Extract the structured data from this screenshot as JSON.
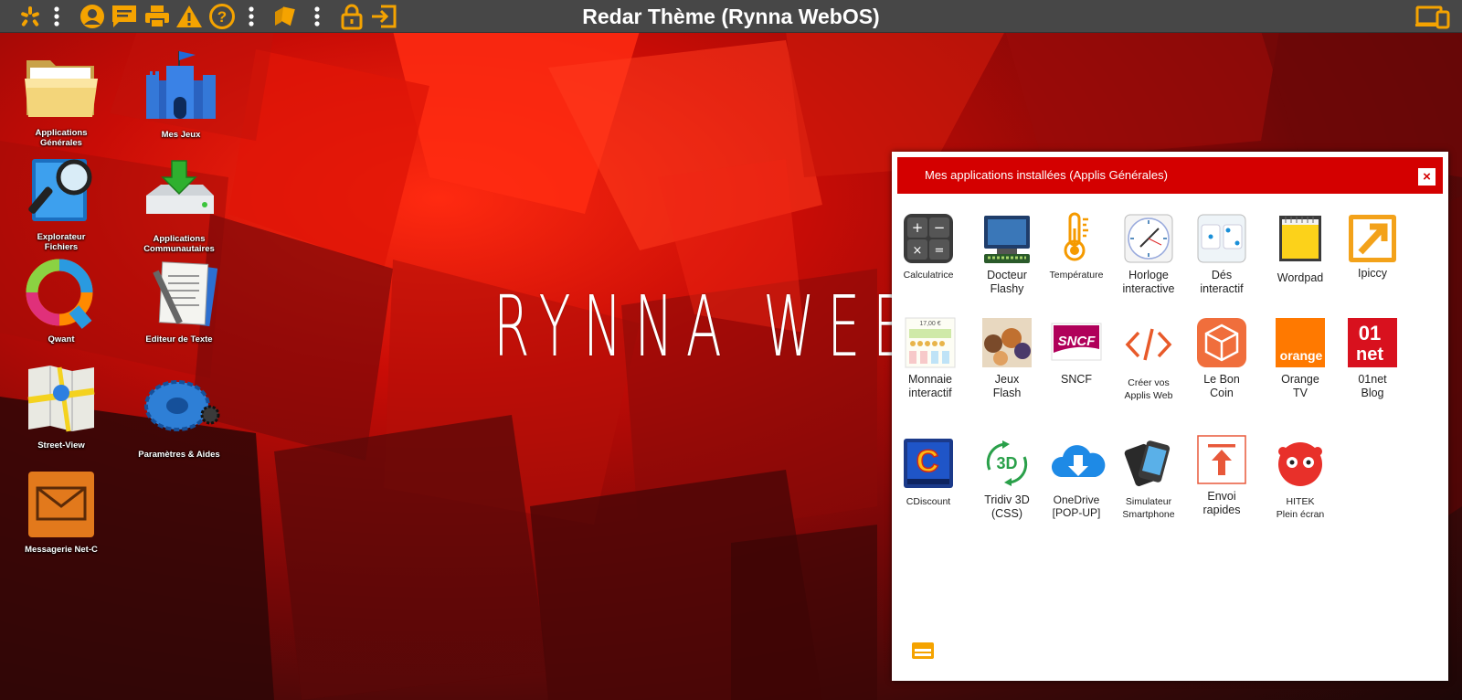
{
  "topbar": {
    "title": "Redar Thème (Rynna WebOS)",
    "icons": [
      "yelp-icon",
      "menu-dots-icon",
      "user-icon",
      "chat-icon",
      "printer-icon",
      "warning-icon",
      "help-icon",
      "menu-dots-icon",
      "tag-icon",
      "menu-dots-icon",
      "lock-icon",
      "logout-icon",
      "devices-icon"
    ],
    "accent": "#f5a300",
    "bar_color": "#474747"
  },
  "wallpaper": {
    "title": "RYNNA WEBOS"
  },
  "desktop_icons": [
    {
      "label_1": "Applications",
      "label_2": "Générales",
      "icon": "folder-icon"
    },
    {
      "label_1": "Mes Jeux",
      "label_2": "",
      "icon": "castle-icon"
    },
    {
      "label_1": "Explorateur",
      "label_2": "Fichiers",
      "icon": "magnifier-icon"
    },
    {
      "label_1": "Applications",
      "label_2": "Communautaires",
      "icon": "download-drive-icon"
    },
    {
      "label_1": "Qwant",
      "label_2": "",
      "icon": "qwant-icon"
    },
    {
      "label_1": "Editeur de Texte",
      "label_2": "",
      "icon": "text-editor-icon"
    },
    {
      "label_1": "Street-View",
      "label_2": "",
      "icon": "map-icon"
    },
    {
      "label_1": "Paramètres & Aides",
      "label_2": "",
      "icon": "gear-icon"
    },
    {
      "label_1": "Messagerie Net-C",
      "label_2": "",
      "icon": "envelope-icon"
    }
  ],
  "window": {
    "title": "Mes applications installées (Applis Générales)",
    "close_label": "×",
    "header_color": "#d40000",
    "apps": [
      {
        "line1": "Calculatrice",
        "line2": "",
        "icon": "calculator-icon"
      },
      {
        "line1": "Docteur",
        "line2": "Flashy",
        "icon": "monitor-icon"
      },
      {
        "line1": "Température",
        "line2": "",
        "icon": "thermometer-icon"
      },
      {
        "line1": "Horloge",
        "line2": "interactive",
        "icon": "clock-icon"
      },
      {
        "line1": "Dés",
        "line2": "interactif",
        "icon": "dice-icon"
      },
      {
        "line1": "Wordpad",
        "line2": "",
        "icon": "notepad-icon"
      },
      {
        "line1": "Ipiccy",
        "line2": "",
        "icon": "ipiccy-icon"
      },
      {
        "line1": "Monnaie",
        "line2": "interactif",
        "icon": "money-icon"
      },
      {
        "line1": "Jeux",
        "line2": "Flash",
        "icon": "games-icon"
      },
      {
        "line1": "SNCF",
        "line2": "",
        "icon": "sncf-icon"
      },
      {
        "line1": "Créer vos",
        "line2": "Applis Web",
        "icon": "code-icon"
      },
      {
        "line1": "Le Bon",
        "line2": "Coin",
        "icon": "box-icon"
      },
      {
        "line1": "Orange",
        "line2": "TV",
        "icon": "orange-icon"
      },
      {
        "line1": "01net",
        "line2": "Blog",
        "icon": "01net-icon"
      },
      {
        "line1": "CDiscount",
        "line2": "",
        "icon": "cdiscount-icon"
      },
      {
        "line1": "Tridiv 3D",
        "line2": "(CSS)",
        "icon": "3d-icon"
      },
      {
        "line1": "OneDrive",
        "line2": "[POP-UP]",
        "icon": "cloud-download-icon"
      },
      {
        "line1": "Simulateur",
        "line2": "Smartphone",
        "icon": "smartphone-icon"
      },
      {
        "line1": "Envoi",
        "line2": "rapides",
        "icon": "upload-icon"
      },
      {
        "line1": "HITEK",
        "line2": "Plein écran",
        "icon": "hitek-icon"
      }
    ],
    "footer_icon": "window-layout-icon",
    "sncf_text": "SNCF",
    "orange_text": "orange",
    "net_text_1": "01",
    "net_text_2": "net",
    "threed_text": "3D",
    "money_text": "17,00 €"
  }
}
